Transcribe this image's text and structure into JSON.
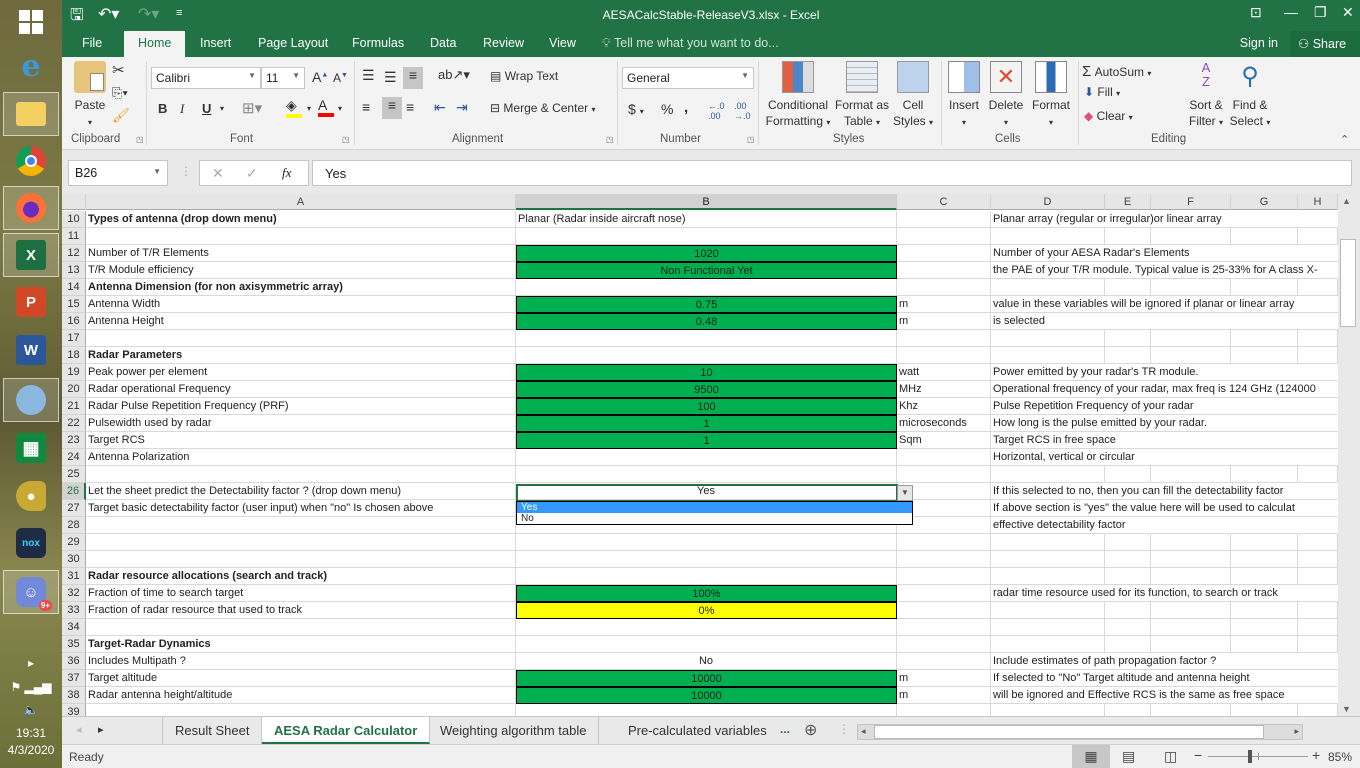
{
  "window": {
    "title": "AESACalcStable-ReleaseV3.xlsx - Excel",
    "controls": [
      "ribbon-display-options-icon",
      "minimize-icon",
      "restore-icon",
      "close-icon"
    ]
  },
  "quick_access": {
    "save": "save-icon",
    "undo": "undo-icon",
    "redo": "redo-icon",
    "customize": "customize-icon"
  },
  "ribbon_tabs": [
    "File",
    "Home",
    "Insert",
    "Page Layout",
    "Formulas",
    "Data",
    "Review",
    "View"
  ],
  "active_tab": "Home",
  "tell_me": "Tell me what you want to do...",
  "sign_in": "Sign in",
  "share": "Share",
  "ribbon": {
    "clipboard": {
      "label": "Clipboard",
      "paste": "Paste"
    },
    "font": {
      "label": "Font",
      "name": "Calibri",
      "size": "11",
      "bold": "B",
      "italic": "I",
      "underline": "U",
      "grow": "A",
      "shrink": "A",
      "fill_color": "#ffff00",
      "font_color": "#ff0000"
    },
    "alignment": {
      "label": "Alignment",
      "wrap_text": "Wrap Text",
      "merge_center": "Merge & Center"
    },
    "number": {
      "label": "Number",
      "format": "General",
      "currency": "$",
      "percent": "%",
      "comma": ",",
      "inc_decimal": "←.0 .00",
      "dec_decimal": ".00 →.0"
    },
    "styles": {
      "label": "Styles",
      "conditional": [
        "Conditional",
        "Formatting"
      ],
      "format_table": [
        "Format as",
        "Table"
      ],
      "cell_styles": [
        "Cell",
        "Styles"
      ]
    },
    "cells": {
      "label": "Cells",
      "insert": "Insert",
      "delete": "Delete",
      "format": "Format"
    },
    "editing": {
      "label": "Editing",
      "autosum": "AutoSum",
      "fill": "Fill",
      "clear": "Clear",
      "sort_filter": [
        "Sort &",
        "Filter"
      ],
      "find_select": [
        "Find &",
        "Select"
      ]
    }
  },
  "formula_bar": {
    "name_box": "B26",
    "formula": "Yes",
    "fx": "fx"
  },
  "columns": [
    "A",
    "B",
    "C",
    "D",
    "E",
    "F",
    "G",
    "H"
  ],
  "selected_column": "B",
  "rows": [
    {
      "n": "10",
      "A": "Types of antenna (drop down menu)",
      "A_bold": true,
      "B": "Planar (Radar inside aircraft nose)",
      "B_style": "left",
      "C": "",
      "D": "Planar array (regular or irregular)or linear array"
    },
    {
      "n": "11",
      "A": "",
      "B": "",
      "C": "",
      "D": ""
    },
    {
      "n": "12",
      "A": "Number of T/R Elements",
      "B": "1020",
      "B_style": "green",
      "C": "",
      "D": "Number of your AESA Radar's Elements"
    },
    {
      "n": "13",
      "A": "T/R Module efficiency",
      "B": "Non Functional Yet",
      "B_style": "green",
      "C": "",
      "D": "the PAE of your T/R module. Typical value is 25-33% for A class X-"
    },
    {
      "n": "14",
      "A": "Antenna Dimension (for non axisymmetric array)",
      "A_bold": true,
      "B": "",
      "C": "",
      "D": ""
    },
    {
      "n": "15",
      "A": "Antenna Width",
      "B": "0.75",
      "B_style": "green",
      "C": "m",
      "D": "value in these variables will be ignored if planar or linear array"
    },
    {
      "n": "16",
      "A": "Antenna Height",
      "B": "0.48",
      "B_style": "green",
      "C": "m",
      "D": "is selected"
    },
    {
      "n": "17",
      "A": "",
      "B": "",
      "C": "",
      "D": ""
    },
    {
      "n": "18",
      "A": "Radar Parameters",
      "A_bold": true,
      "B": "",
      "C": "",
      "D": ""
    },
    {
      "n": "19",
      "A": "Peak power per element",
      "B": "10",
      "B_style": "green",
      "C": "watt",
      "D": "Power emitted by your radar's TR module."
    },
    {
      "n": "20",
      "A": "Radar operational Frequency",
      "B": "9500",
      "B_style": "green",
      "C": "MHz",
      "D": "Operational frequency of your radar, max freq is 124 GHz (124000"
    },
    {
      "n": "21",
      "A": "Radar Pulse Repetition Frequency (PRF)",
      "B": "100",
      "B_style": "green",
      "C": "Khz",
      "D": "Pulse Repetition Frequency of your radar"
    },
    {
      "n": "22",
      "A": "Pulsewidth used by radar",
      "B": "1",
      "B_style": "green",
      "C": "microseconds",
      "D": "How long is the pulse emitted by your radar."
    },
    {
      "n": "23",
      "A": "Target RCS",
      "B": "1",
      "B_style": "green",
      "C": "Sqm",
      "D": "Target RCS in free space"
    },
    {
      "n": "24",
      "A": "Antenna Polarization",
      "B": "",
      "C": "",
      "D": "Horizontal, vertical or circular"
    },
    {
      "n": "25",
      "A": "",
      "B": "",
      "C": "",
      "D": ""
    },
    {
      "n": "26",
      "A": "Let the sheet predict the Detectability factor ? (drop down menu)",
      "B": "Yes",
      "C": "",
      "D": "If this selected to no, then you can fill the detectability factor",
      "selected": true
    },
    {
      "n": "27",
      "A": "Target basic detectability factor (user input) when \"no\" Is chosen above",
      "B": "",
      "C": "",
      "D": "If above section is \"yes\" the value here will be used to calculat"
    },
    {
      "n": "28",
      "A": "",
      "B": "",
      "C": "",
      "D": "effective detectability factor"
    },
    {
      "n": "29",
      "A": "",
      "B": "",
      "C": "",
      "D": ""
    },
    {
      "n": "30",
      "A": "",
      "B": "",
      "C": "",
      "D": ""
    },
    {
      "n": "31",
      "A": "Radar resource allocations (search and track)",
      "A_bold": true,
      "B": "",
      "C": "",
      "D": ""
    },
    {
      "n": "32",
      "A": "Fraction of time to search target",
      "B": "100%",
      "B_style": "green",
      "C": "",
      "D": "radar time resource used for its function, to search or track"
    },
    {
      "n": "33",
      "A": "Fraction of radar resource that used to track",
      "B": "0%",
      "B_style": "yellow",
      "C": "",
      "D": ""
    },
    {
      "n": "34",
      "A": "",
      "B": "",
      "C": "",
      "D": ""
    },
    {
      "n": "35",
      "A": "Target-Radar Dynamics",
      "A_bold": true,
      "B": "",
      "C": "",
      "D": ""
    },
    {
      "n": "36",
      "A": "Includes Multipath ?",
      "B": "No",
      "C": "",
      "D": "Include estimates of path propagation factor ?"
    },
    {
      "n": "37",
      "A": "Target altitude",
      "B": "10000",
      "B_style": "green",
      "C": "m",
      "D": "If selected to \"No\" Target altitude and antenna height"
    },
    {
      "n": "38",
      "A": "Radar antenna height/altitude",
      "B": "10000",
      "B_style": "green",
      "C": "m",
      "D": "will be ignored and Effective RCS is the same as free space"
    },
    {
      "n": "39",
      "A": "",
      "B": "",
      "C": "",
      "D": ""
    }
  ],
  "dropdown": {
    "options": [
      "Yes",
      "No"
    ],
    "highlighted": "Yes"
  },
  "sheet_tabs": [
    "Result Sheet",
    "AESA Radar Calculator",
    "Weighting algorithm table",
    "Pre-calculated variables"
  ],
  "active_sheet": "AESA Radar Calculator",
  "more_sheets": "...",
  "status": {
    "text": "Ready",
    "zoom": "85%",
    "zoom_fraction": 0.85
  },
  "taskbar": {
    "apps": [
      "Start",
      "Internet Explorer",
      "File Explorer",
      "Google Chrome",
      "Firefox",
      "Excel",
      "PowerPoint",
      "Word",
      "Paint",
      "Calculator",
      "Bird app",
      "Nox",
      "Discord"
    ],
    "discord_badge": "9+",
    "time": "19:31",
    "date": "4/3/2020"
  }
}
